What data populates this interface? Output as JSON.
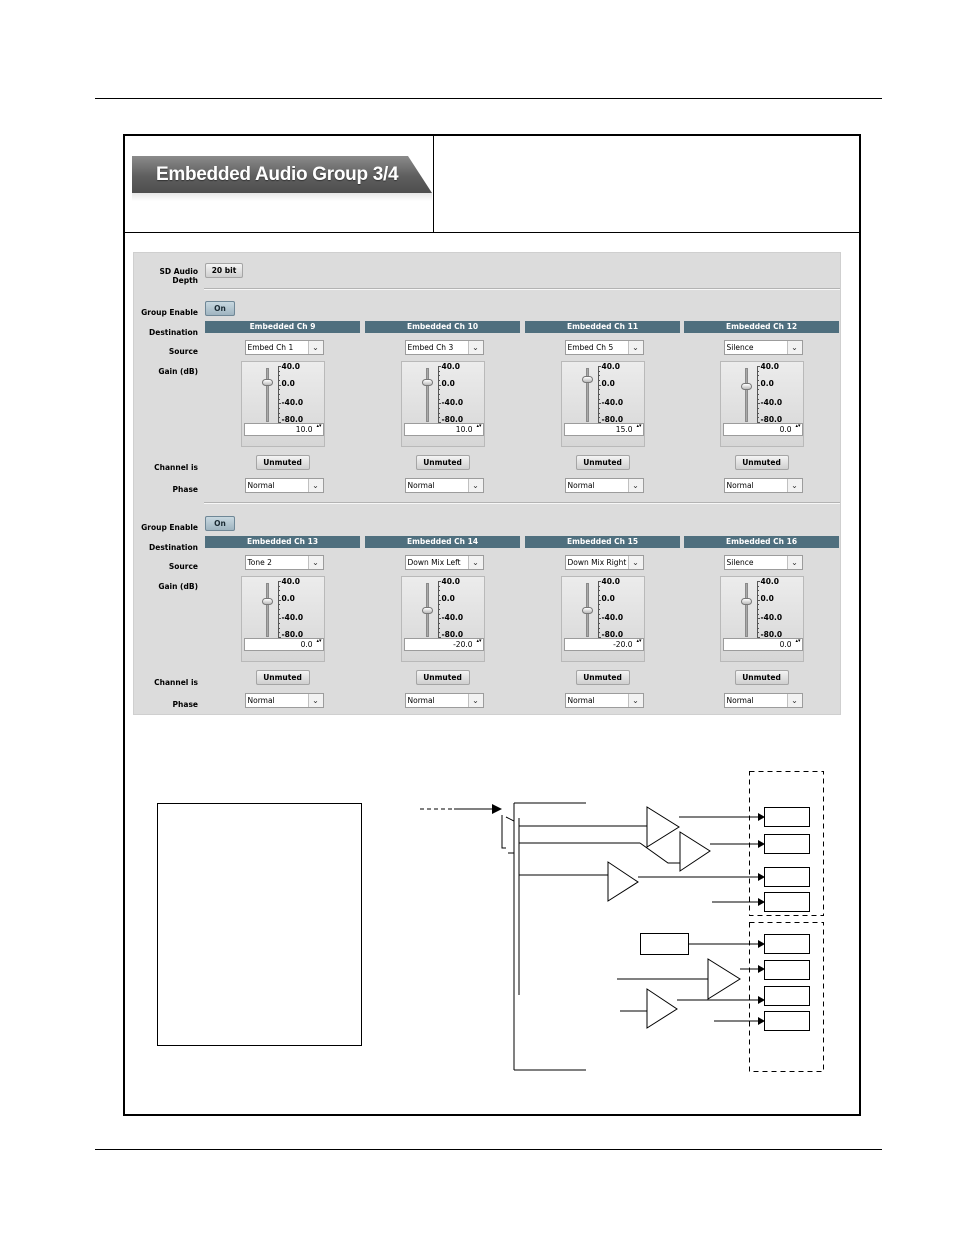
{
  "header": {
    "tab_title": "Embedded Audio Group 3/4"
  },
  "panel": {
    "sd_audio_depth": {
      "label": "SD Audio Depth",
      "value": "20 bit"
    },
    "row_labels": {
      "group_enable": "Group Enable",
      "destination": "Destination",
      "source": "Source",
      "gain": "Gain (dB)",
      "channel_is": "Channel is",
      "phase": "Phase"
    },
    "scale_ticks": [
      "40.0",
      "0.0",
      "-40.0",
      "-80.0"
    ],
    "groups": [
      {
        "enable": "On",
        "channels": [
          {
            "destination": "Embedded Ch 9",
            "source": "Embed Ch 1",
            "gain": "10.0",
            "gain_level": 10,
            "mute": "Unmuted",
            "phase": "Normal"
          },
          {
            "destination": "Embedded Ch 10",
            "source": "Embed Ch 3",
            "gain": "10.0",
            "gain_level": 10,
            "mute": "Unmuted",
            "phase": "Normal"
          },
          {
            "destination": "Embedded Ch 11",
            "source": "Embed Ch 5",
            "gain": "15.0",
            "gain_level": 15,
            "mute": "Unmuted",
            "phase": "Normal"
          },
          {
            "destination": "Embedded Ch 12",
            "source": "Silence",
            "gain": "0.0",
            "gain_level": 0,
            "mute": "Unmuted",
            "phase": "Normal"
          }
        ]
      },
      {
        "enable": "On",
        "channels": [
          {
            "destination": "Embedded Ch 13",
            "source": "Tone 2",
            "gain": "0.0",
            "gain_level": 0,
            "mute": "Unmuted",
            "phase": "Normal"
          },
          {
            "destination": "Embedded Ch 14",
            "source": "Down Mix Left",
            "gain": "-20.0",
            "gain_level": -20,
            "mute": "Unmuted",
            "phase": "Normal"
          },
          {
            "destination": "Embedded Ch 15",
            "source": "Down Mix Right",
            "gain": "-20.0",
            "gain_level": -20,
            "mute": "Unmuted",
            "phase": "Normal"
          },
          {
            "destination": "Embedded Ch 16",
            "source": "Silence",
            "gain": "0.0",
            "gain_level": 0,
            "mute": "Unmuted",
            "phase": "Normal"
          }
        ]
      }
    ]
  },
  "icons": {
    "dropdown": "chevron-down-icon",
    "spinner": "spinner-arrows-icon"
  }
}
